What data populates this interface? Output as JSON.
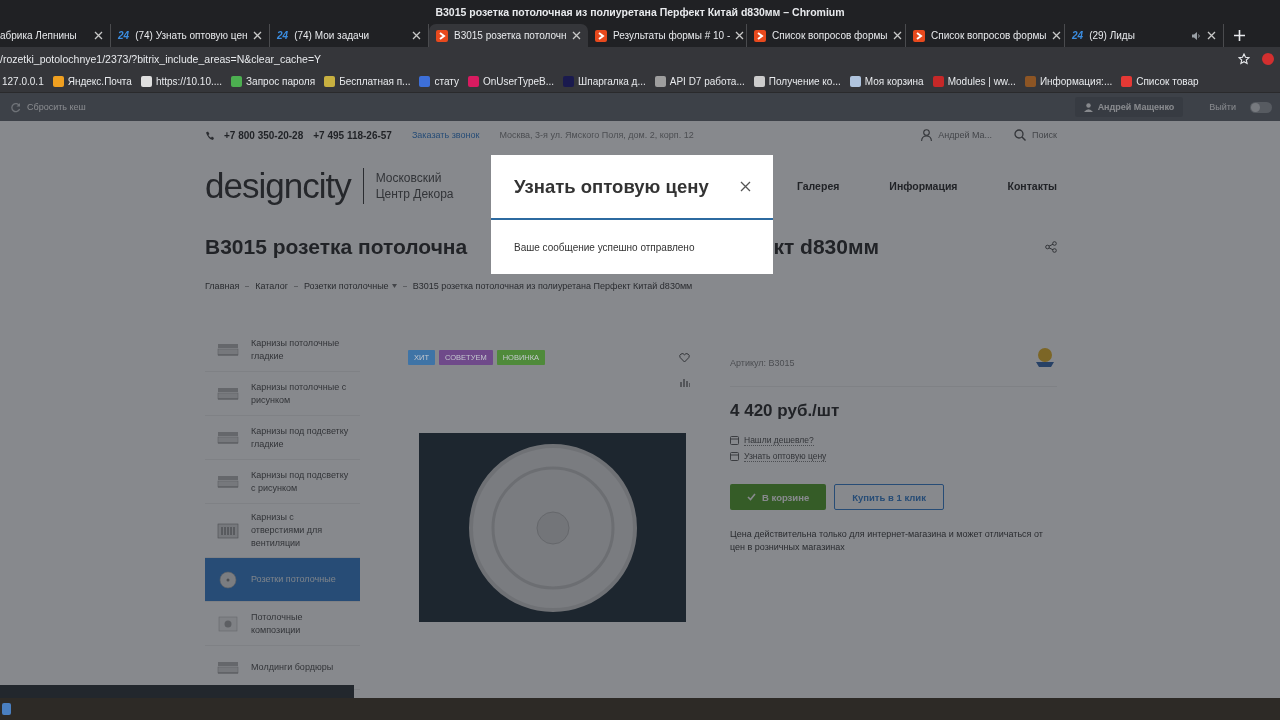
{
  "window": {
    "title": "B3015 розетка потолочная из полиуретана Перфект Китай d830мм – Chromium"
  },
  "tabs": [
    {
      "label": "абрика Лепнины",
      "kind": "none",
      "selected": false
    },
    {
      "label": "(74) Узнать оптовую цен",
      "kind": "bitrix",
      "favicon_text": "24",
      "selected": false
    },
    {
      "label": "(74) Мои задачи",
      "kind": "bitrix",
      "favicon_text": "24",
      "selected": false
    },
    {
      "label": "B3015 розетка потолочн",
      "kind": "chevron",
      "selected": true
    },
    {
      "label": "Результаты формы # 10 -",
      "kind": "chevron",
      "selected": false
    },
    {
      "label": "Список вопросов формы",
      "kind": "chevron",
      "selected": false
    },
    {
      "label": "Список вопросов формы",
      "kind": "chevron",
      "selected": false
    },
    {
      "label": "(29) Лиды",
      "kind": "bitrix",
      "favicon_text": "24",
      "audio": true,
      "selected": false
    }
  ],
  "address_bar": {
    "url": "/rozetki_potolochnye1/2373/?bitrix_include_areas=N&clear_cache=Y"
  },
  "bookmarks": [
    {
      "label": "127.0.0.1"
    },
    {
      "label": "Яндекс.Почта",
      "color": "#f0a020"
    },
    {
      "label": "https://10.10....",
      "color": "#e0e0e0"
    },
    {
      "label": "Запрос пароля",
      "color": "#4caf50"
    },
    {
      "label": "Бесплатная п...",
      "color": "#c8b040"
    },
    {
      "label": "стату",
      "color": "#3d6fd8"
    },
    {
      "label": "OnUserTypeB...",
      "color": "#d81b60"
    },
    {
      "label": "Шпаргалка д...",
      "color": "#1a1a4e"
    },
    {
      "label": "API D7 работа...",
      "color": "#9e9e9e"
    },
    {
      "label": "Получение ко...",
      "color": "#cccccc"
    },
    {
      "label": "Моя корзина",
      "color": "#b0c4de"
    },
    {
      "label": "Modules | ww...",
      "color": "#c62828"
    },
    {
      "label": "Информация:...",
      "color": "#8d5524"
    },
    {
      "label": "Список товар",
      "color": "#e53935"
    }
  ],
  "admin_panel": {
    "reset_cache": "Сбросить кеш",
    "user": "Андрей Мащенко",
    "logout": "Выйти",
    "toggle_on": false
  },
  "site_header": {
    "phones": [
      "+7 800 350-20-28",
      "+7 495 118-26-57"
    ],
    "callback_link": "Заказать звонок",
    "address": "Москва, 3-я ул. Ямского Поля, дом. 2, корп. 12",
    "user": "Андрей Ма...",
    "search": "Поиск",
    "logo": "designcity",
    "tagline": [
      "Московский",
      "Центр Декора"
    ],
    "nav": [
      "Галерея",
      "Информация",
      "Контакты"
    ]
  },
  "page_title_parts": [
    "B3015 розетка потолочна",
    "кт d830мм"
  ],
  "breadcrumbs": [
    {
      "label": "Главная",
      "dropdown": false
    },
    {
      "label": "Каталог",
      "dropdown": false
    },
    {
      "label": "Розетки потолочные",
      "dropdown": true
    },
    {
      "label": "B3015 розетка потолочная из полиуретана Перфект Китай d830мм",
      "dropdown": false
    }
  ],
  "sidebar": {
    "items": [
      {
        "label": "Карнизы потолочные гладкие",
        "kind": "cornice",
        "selected": false
      },
      {
        "label": "Карнизы потолочные с рисунком",
        "kind": "cornice",
        "selected": false
      },
      {
        "label": "Карнизы под подсветку гладкие",
        "kind": "cornice",
        "selected": false
      },
      {
        "label": "Карнизы под подсветку с рисунком",
        "kind": "cornice",
        "selected": false
      },
      {
        "label": "Карнизы с отверстиями для вентиляции",
        "kind": "vent",
        "selected": false
      },
      {
        "label": "Розетки потолочные",
        "kind": "rosette",
        "selected": true
      },
      {
        "label": "Потолочные композиции",
        "kind": "composition",
        "selected": false
      },
      {
        "label": "Молдинги бордюры",
        "kind": "cornice",
        "selected": false
      }
    ]
  },
  "product": {
    "badges": [
      {
        "label": "ХИТ",
        "color": "#3f74a6"
      },
      {
        "label": "СОВЕТУЕМ",
        "color": "#6f4a8a"
      },
      {
        "label": "НОВИНКА",
        "color": "#4f8a3a"
      }
    ],
    "article": "Артикул: B3015",
    "price": "4 420 руб./шт",
    "links": [
      "Нашли дешевле?",
      "Узнать оптовую цену"
    ],
    "buttons": [
      {
        "label": "В корзине",
        "kind": "in-cart"
      },
      {
        "label": "Купить в 1 клик",
        "kind": "outline"
      }
    ],
    "note": "Цена действительна только для интернет-магазина и может отличаться от цен в розничных магазинах"
  },
  "modal": {
    "title": "Узнать оптовую цену",
    "message": "Ваше сообщение успешно отправлено"
  }
}
